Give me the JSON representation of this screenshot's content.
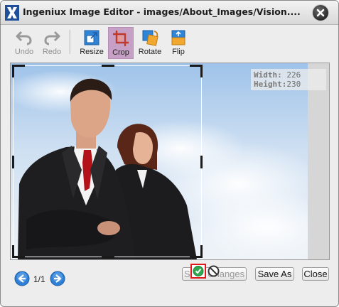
{
  "window": {
    "title": "Ingeniux Image Editor - images/About_Images/Vision...."
  },
  "toolbar": {
    "items": [
      {
        "label": "Undo",
        "icon": "undo-icon",
        "enabled": false
      },
      {
        "label": "Redo",
        "icon": "redo-icon",
        "enabled": false
      },
      {
        "label": "Resize",
        "icon": "resize-icon",
        "enabled": true
      },
      {
        "label": "Crop",
        "icon": "crop-icon",
        "enabled": true,
        "active": true
      },
      {
        "label": "Rotate",
        "icon": "rotate-icon",
        "enabled": true
      },
      {
        "label": "Flip",
        "icon": "flip-icon",
        "enabled": true
      }
    ]
  },
  "canvas": {
    "image_subject": "businessman-and-businesswoman-against-sky",
    "width_label": "Width:",
    "width_value": "226",
    "height_label": "Height:",
    "height_value": "230"
  },
  "footer": {
    "page_indicator": "1/1",
    "save_changes_label": "Save Changes",
    "save_changes_enabled": false,
    "save_as_label": "Save As",
    "close_label": "Close"
  },
  "colors": {
    "active_tool": "#c7a0c6",
    "accept_highlight": "#e0171b",
    "accept_green": "#2fa84f",
    "nav_blue": "#2f7fd4"
  }
}
